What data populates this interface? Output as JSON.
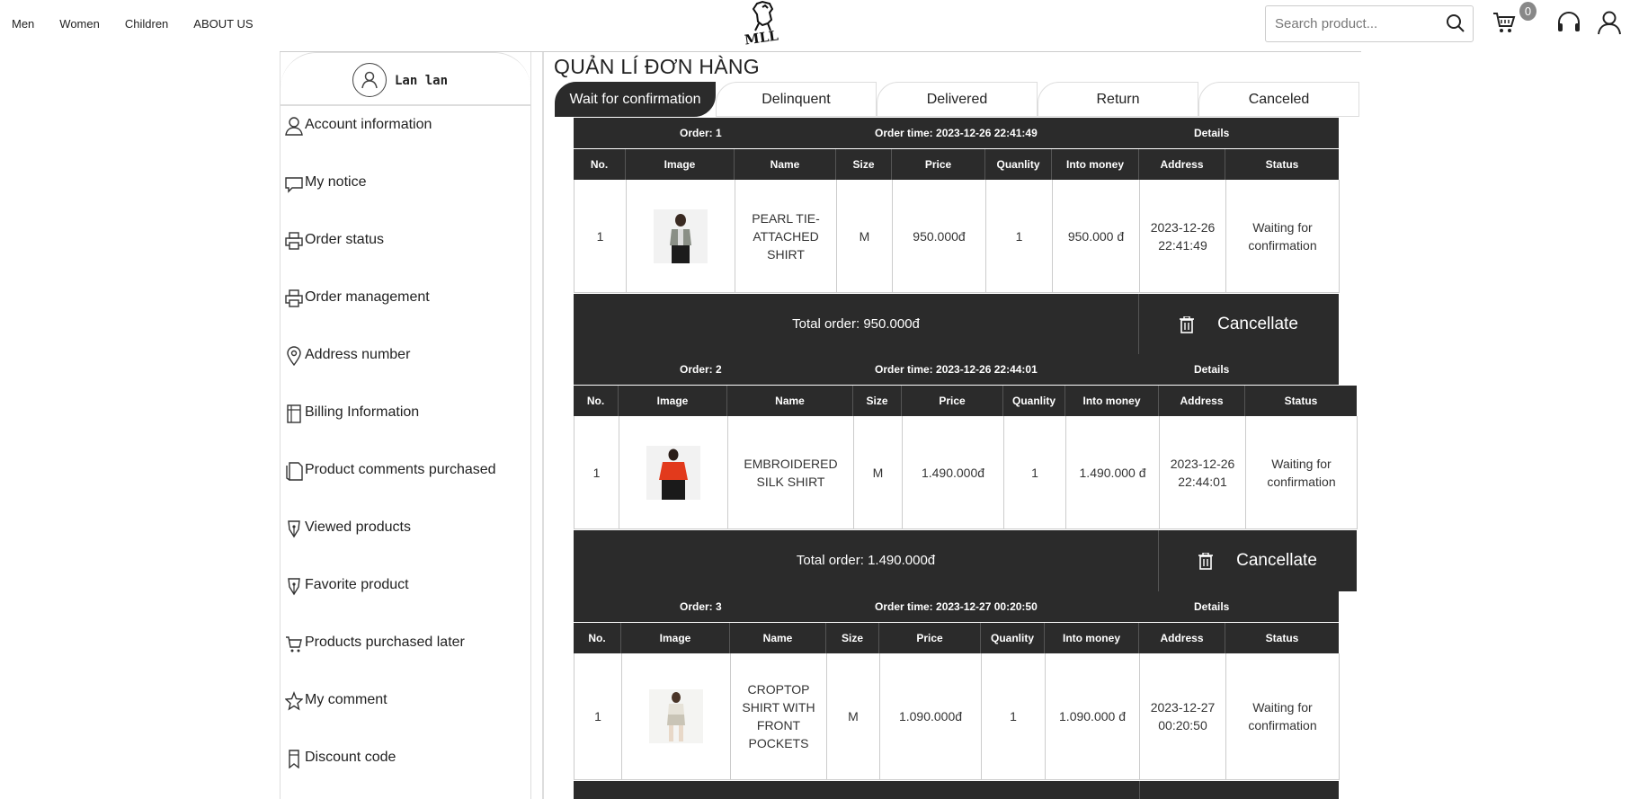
{
  "nav": {
    "links": [
      "Men",
      "Women",
      "Children",
      "ABOUT US"
    ]
  },
  "logo_text": "MLL",
  "search": {
    "placeholder": "Search product..."
  },
  "cart_count": "0",
  "user": {
    "name": "Lan lan"
  },
  "sidebar": {
    "items": [
      {
        "label": "Account information",
        "icon": "user-icon"
      },
      {
        "label": "My notice",
        "icon": "chat-icon"
      },
      {
        "label": "Order status",
        "icon": "printer-icon"
      },
      {
        "label": "Order management",
        "icon": "printer-icon"
      },
      {
        "label": "Address number",
        "icon": "location-pin-icon"
      },
      {
        "label": "Billing Information",
        "icon": "building-icon"
      },
      {
        "label": "Product comments purchased",
        "icon": "document-icon"
      },
      {
        "label": "Viewed products",
        "icon": "pen-nib-icon"
      },
      {
        "label": "Favorite product",
        "icon": "pen-nib-icon"
      },
      {
        "label": "Products purchased later",
        "icon": "cart-icon"
      },
      {
        "label": "My comment",
        "icon": "star-icon"
      },
      {
        "label": "Discount code",
        "icon": "bookmark-icon"
      }
    ]
  },
  "page_title": "QUẢN LÍ ĐƠN HÀNG",
  "tabs": [
    "Wait for confirmation",
    "Delinquent",
    "Delivered",
    "Return",
    "Canceled"
  ],
  "active_tab": "Wait for confirmation",
  "columns": [
    "No.",
    "Image",
    "Name",
    "Size",
    "Price",
    "Quanlity",
    "Into money",
    "Address",
    "Status"
  ],
  "orders": [
    {
      "order_label": "Order: 1",
      "time_label": "Order time: 2023-12-26 22:41:49",
      "details_label": "Details",
      "row": {
        "no": "1",
        "name": "PEARL TIE-ATTACHED SHIRT",
        "size": "M",
        "price": "950.000đ",
        "qty": "1",
        "money": "950.000 đ",
        "address": "2023-12-26 22:41:49",
        "status": "Waiting for confirmation"
      },
      "total": "Total order: 950.000đ",
      "cancel_label": "Cancellate"
    },
    {
      "order_label": "Order: 2",
      "time_label": "Order time: 2023-12-26 22:44:01",
      "details_label": "Details",
      "row": {
        "no": "1",
        "name": "EMBROIDERED SILK SHIRT",
        "size": "M",
        "price": "1.490.000đ",
        "qty": "1",
        "money": "1.490.000 đ",
        "address": "2023-12-26 22:44:01",
        "status": "Waiting for confirmation"
      },
      "total": "Total order: 1.490.000đ",
      "cancel_label": "Cancellate"
    },
    {
      "order_label": "Order: 3",
      "time_label": "Order time: 2023-12-27 00:20:50",
      "details_label": "Details",
      "row": {
        "no": "1",
        "name": "CROPTOP SHIRT WITH FRONT POCKETS",
        "size": "M",
        "price": "1.090.000đ",
        "qty": "1",
        "money": "1.090.000 đ",
        "address": "2023-12-27 00:20:50",
        "status": "Waiting for confirmation"
      }
    }
  ],
  "colors": {
    "dark": "#2b2b2b",
    "status_red": "#e01b1b"
  }
}
